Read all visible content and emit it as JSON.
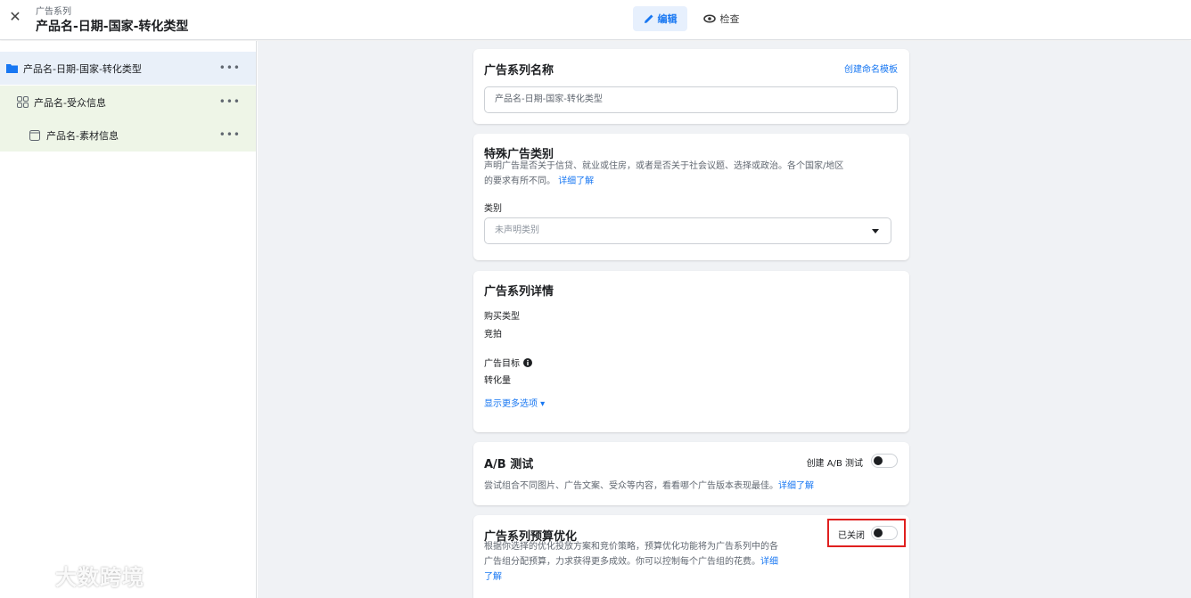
{
  "header": {
    "crumb_small": "广告系列",
    "crumb_title": "产品名-日期-国家-转化类型",
    "tab_edit": "编辑",
    "tab_review": "检查"
  },
  "sidebar": {
    "items": [
      {
        "label": "产品名-日期-国家-转化类型",
        "icon": "folder-icon"
      },
      {
        "label": "产品名-受众信息",
        "icon": "grid-icon"
      },
      {
        "label": "产品名-素材信息",
        "icon": "ad-icon"
      }
    ],
    "more_label": "•••"
  },
  "campaign_name": {
    "title": "广告系列名称",
    "link": "创建命名模板",
    "value": "产品名-日期-国家-转化类型"
  },
  "special_category": {
    "title": "特殊广告类别",
    "desc_line1": "声明广告是否关于信贷、就业或住房，或者是否关于社会议题、选择或政治。各个国家/地区",
    "desc_line2": "的要求有所不同。",
    "learn_more": "详细了解",
    "category_label": "类别",
    "category_value": "未声明类别"
  },
  "campaign_details": {
    "title": "广告系列详情",
    "buy_type_label": "购买类型",
    "buy_type_value": "竞拍",
    "objective_label": "广告目标",
    "objective_value": "转化量",
    "more_options": "显示更多选项 ▾"
  },
  "ab_test": {
    "title": "A/B 测试",
    "toggle_label": "创建 A/B 测试",
    "desc": "尝试组合不同图片、广告文案、受众等内容，看看哪个广告版本表现最佳。",
    "learn_more": "详细了解"
  },
  "budget_opt": {
    "title": "广告系列预算优化",
    "toggle_label": "已关闭",
    "desc_line1": "根据你选择的优化投放方案和竞价策略，预算优化功能将为广告系列中的各",
    "desc_line2": "广告组分配预算，力求获得更多成效。你可以控制每个广告组的花费。",
    "learn_more_1": "详细",
    "learn_more_2": "了解"
  },
  "watermark": "大数跨境",
  "colors": {
    "accent": "#1877f2",
    "highlight": "#e0201f",
    "background": "#f0f2f5"
  }
}
